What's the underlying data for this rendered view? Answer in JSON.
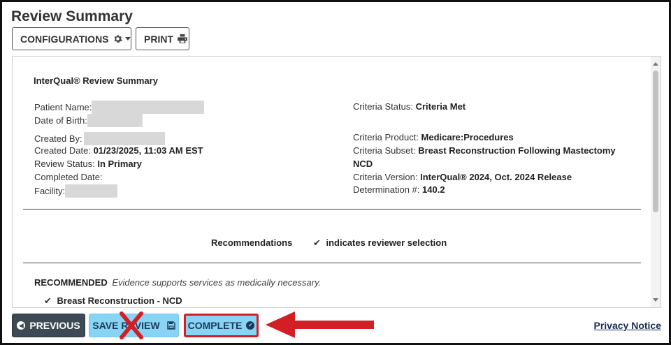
{
  "page": {
    "title": "Review Summary"
  },
  "toolbar": {
    "configurations_label": "CONFIGURATIONS",
    "print_label": "PRINT"
  },
  "summary": {
    "heading": "InterQual® Review Summary",
    "left": {
      "patient_name_label": "Patient Name:",
      "dob_label": "Date of Birth:",
      "created_by_label": "Created By:",
      "created_date_label": "Created Date:",
      "created_date_value": "01/23/2025, 11:03 AM EST",
      "review_status_label": "Review Status:",
      "review_status_value": "In Primary",
      "completed_date_label": "Completed Date:",
      "facility_label": "Facility:"
    },
    "right": {
      "criteria_status_label": "Criteria Status:",
      "criteria_status_value": "Criteria Met",
      "criteria_product_label": "Criteria Product:",
      "criteria_product_value": "Medicare:Procedures",
      "criteria_subset_label": "Criteria Subset:",
      "criteria_subset_value": "Breast Reconstruction Following Mastectomy",
      "criteria_subset_value_cont": "NCD",
      "criteria_version_label": "Criteria Version:",
      "criteria_version_value": "InterQual® 2024, Oct. 2024 Release",
      "determination_label": "Determination #:",
      "determination_value": "140.2"
    }
  },
  "recommendations": {
    "title": "Recommendations",
    "legend": "indicates reviewer selection",
    "recommended_label": "RECOMMENDED",
    "recommended_note": "Evidence supports services as medically necessary.",
    "item": "Breast Reconstruction - NCD"
  },
  "footer": {
    "previous_label": "PREVIOUS",
    "save_review_label": "SAVE REVIEW",
    "complete_label": "COMPLETE",
    "privacy_label": "Privacy Notice"
  },
  "colors": {
    "primary_dark": "#3d4a55",
    "accent_light": "#88d4f4",
    "annotation_red": "#d21f26"
  }
}
